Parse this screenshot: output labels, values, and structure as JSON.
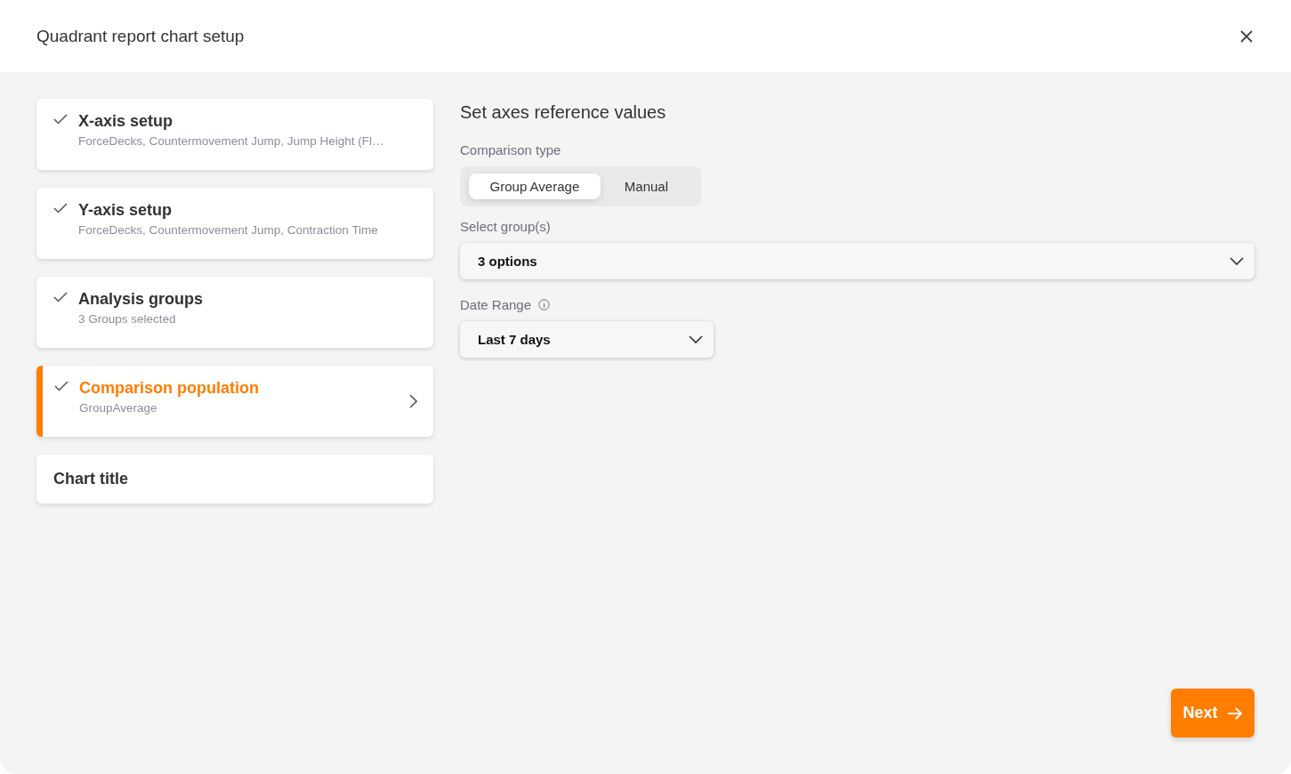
{
  "window": {
    "title": "Quadrant report chart setup"
  },
  "steps": [
    {
      "title": "X-axis setup",
      "subtitle": "ForceDecks, Countermovement Jump, Jump Height (Fl…",
      "checked": true,
      "selected": false
    },
    {
      "title": "Y-axis setup",
      "subtitle": "ForceDecks, Countermovement Jump, Contraction Time",
      "checked": true,
      "selected": false
    },
    {
      "title": "Analysis groups",
      "subtitle": "3 Groups selected",
      "checked": true,
      "selected": false
    },
    {
      "title": "Comparison population",
      "subtitle": "GroupAverage",
      "checked": true,
      "selected": true
    },
    {
      "title": "Chart title",
      "checked": false,
      "selected": false
    }
  ],
  "panel": {
    "heading": "Set axes reference values",
    "comparison_type": {
      "label": "Comparison type",
      "options": [
        {
          "label": "Group Average",
          "selected": true
        },
        {
          "label": "Manual",
          "selected": false
        }
      ]
    },
    "groups": {
      "label": "Select group(s)",
      "value": "3 options"
    },
    "date_range": {
      "label": "Date Range",
      "value": "Last 7 days"
    }
  },
  "next_button": "Next"
}
